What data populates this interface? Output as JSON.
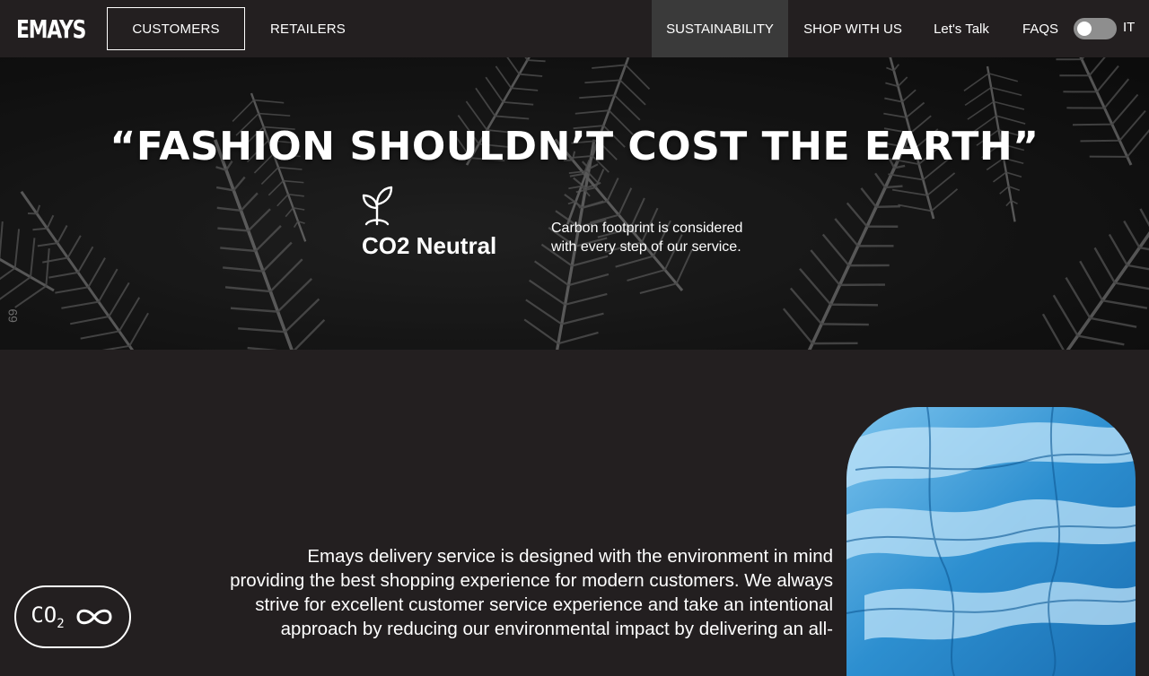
{
  "brand": {
    "logo": "EMAYS"
  },
  "nav": {
    "left": [
      {
        "label": "CUSTOMERS",
        "active": true
      },
      {
        "label": "RETAILERS",
        "active": false
      }
    ],
    "right": [
      {
        "label": "SUSTAINABILITY",
        "active": true
      },
      {
        "label": "SHOP WITH US"
      },
      {
        "label": "Let's Talk"
      },
      {
        "label": "FAQS"
      }
    ],
    "language_toggle": {
      "label": "IT",
      "on": false
    }
  },
  "hero": {
    "quote": "“FASHION SHOULDN’T COST THE EARTH”",
    "feature_title": "CO2 Neutral",
    "feature_icon": "sprout-icon",
    "feature_desc_line1": "Carbon footprint is considered",
    "feature_desc_line2": "with every step of our service.",
    "side_number": "69"
  },
  "intro": {
    "line1": "Emays delivery service is designed with the environment in mind",
    "line2": "providing the best shopping experience for modern customers. We always",
    "line3": "strive for excellent customer service experience and take an intentional",
    "line4": "approach by reducing our environmental impact by delivering an all-"
  },
  "badge": {
    "main": "CO",
    "sub": "2",
    "icon": "infinity-icon"
  },
  "colors": {
    "background": "#231f20",
    "nav_active": "#3a3a3a",
    "toggle": "#8e8e8e",
    "text": "#ffffff",
    "glacier": "#3aa0dc"
  }
}
